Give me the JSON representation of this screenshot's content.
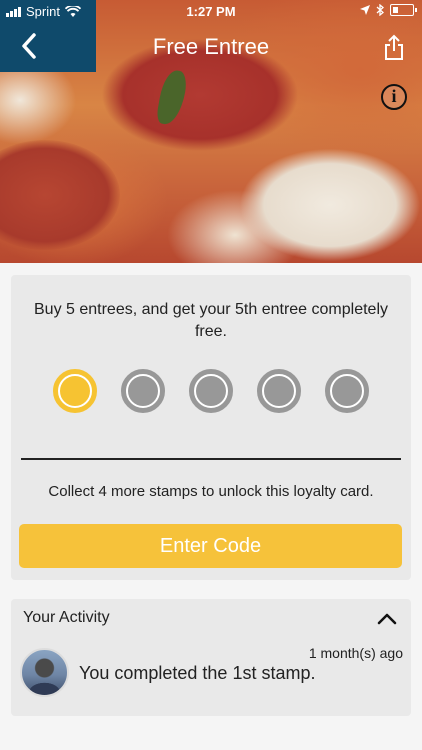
{
  "status_bar": {
    "carrier": "Sprint",
    "time": "1:27 PM"
  },
  "header": {
    "title": "Free Entree",
    "back_icon": "chevron-left-icon",
    "share_icon": "share-icon",
    "info_label": "i"
  },
  "loyalty_card": {
    "description": "Buy 5 entrees, and get your 5th entree completely free.",
    "stamps_total": 5,
    "stamps_collected": 1,
    "unlock_text": "Collect 4 more stamps to unlock this loyalty card.",
    "enter_code_label": "Enter Code",
    "colors": {
      "filled_stamp": "#f6c332",
      "empty_stamp": "#989898",
      "button": "#f6c23a"
    }
  },
  "activity": {
    "title": "Your Activity",
    "items": [
      {
        "time": "1 month(s) ago",
        "text": "You completed the 1st stamp."
      }
    ]
  },
  "colors": {
    "header_back_block": "#0f4a6b"
  }
}
